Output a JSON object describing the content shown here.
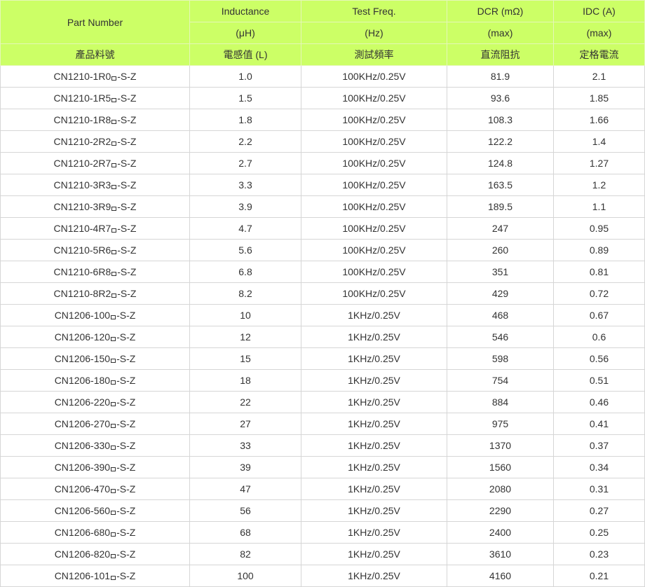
{
  "header": {
    "part_number": "Part Number",
    "part_number_zh": "產品料號",
    "inductance": "Inductance",
    "inductance_unit": "(μH)",
    "inductance_zh": "電感值 (L)",
    "test_freq": "Test Freq.",
    "test_freq_unit": "(Hz)",
    "test_freq_zh": "測試頻率",
    "dcr": "DCR (mΩ)",
    "dcr_unit": "(max)",
    "dcr_zh": "直流阻抗",
    "idc": "IDC (A)",
    "idc_unit": "(max)",
    "idc_zh": "定格電流"
  },
  "rows": [
    {
      "part_prefix": "CN1210-1R0",
      "part_suffix": "-S-Z",
      "inductance": "1.0",
      "freq": "100KHz/0.25V",
      "dcr": "81.9",
      "idc": "2.1"
    },
    {
      "part_prefix": "CN1210-1R5",
      "part_suffix": "-S-Z",
      "inductance": "1.5",
      "freq": "100KHz/0.25V",
      "dcr": "93.6",
      "idc": "1.85"
    },
    {
      "part_prefix": "CN1210-1R8",
      "part_suffix": "-S-Z",
      "inductance": "1.8",
      "freq": "100KHz/0.25V",
      "dcr": "108.3",
      "idc": "1.66"
    },
    {
      "part_prefix": "CN1210-2R2",
      "part_suffix": "-S-Z",
      "inductance": "2.2",
      "freq": "100KHz/0.25V",
      "dcr": "122.2",
      "idc": "1.4"
    },
    {
      "part_prefix": "CN1210-2R7",
      "part_suffix": "-S-Z",
      "inductance": "2.7",
      "freq": "100KHz/0.25V",
      "dcr": "124.8",
      "idc": "1.27"
    },
    {
      "part_prefix": "CN1210-3R3",
      "part_suffix": "-S-Z",
      "inductance": "3.3",
      "freq": "100KHz/0.25V",
      "dcr": "163.5",
      "idc": "1.2"
    },
    {
      "part_prefix": "CN1210-3R9",
      "part_suffix": "-S-Z",
      "inductance": "3.9",
      "freq": "100KHz/0.25V",
      "dcr": "189.5",
      "idc": "1.1"
    },
    {
      "part_prefix": "CN1210-4R7",
      "part_suffix": "-S-Z",
      "inductance": "4.7",
      "freq": "100KHz/0.25V",
      "dcr": "247",
      "idc": "0.95"
    },
    {
      "part_prefix": "CN1210-5R6",
      "part_suffix": "-S-Z",
      "inductance": "5.6",
      "freq": "100KHz/0.25V",
      "dcr": "260",
      "idc": "0.89"
    },
    {
      "part_prefix": "CN1210-6R8",
      "part_suffix": "-S-Z",
      "inductance": "6.8",
      "freq": "100KHz/0.25V",
      "dcr": "351",
      "idc": "0.81"
    },
    {
      "part_prefix": "CN1210-8R2",
      "part_suffix": "-S-Z",
      "inductance": "8.2",
      "freq": "100KHz/0.25V",
      "dcr": "429",
      "idc": "0.72"
    },
    {
      "part_prefix": "CN1206-100",
      "part_suffix": "-S-Z",
      "inductance": "10",
      "freq": "1KHz/0.25V",
      "dcr": "468",
      "idc": "0.67"
    },
    {
      "part_prefix": "CN1206-120",
      "part_suffix": "-S-Z",
      "inductance": "12",
      "freq": "1KHz/0.25V",
      "dcr": "546",
      "idc": "0.6"
    },
    {
      "part_prefix": "CN1206-150",
      "part_suffix": "-S-Z",
      "inductance": "15",
      "freq": "1KHz/0.25V",
      "dcr": "598",
      "idc": "0.56"
    },
    {
      "part_prefix": "CN1206-180",
      "part_suffix": "-S-Z",
      "inductance": "18",
      "freq": "1KHz/0.25V",
      "dcr": "754",
      "idc": "0.51"
    },
    {
      "part_prefix": "CN1206-220",
      "part_suffix": "-S-Z",
      "inductance": "22",
      "freq": "1KHz/0.25V",
      "dcr": "884",
      "idc": "0.46"
    },
    {
      "part_prefix": "CN1206-270",
      "part_suffix": "-S-Z",
      "inductance": "27",
      "freq": "1KHz/0.25V",
      "dcr": "975",
      "idc": "0.41"
    },
    {
      "part_prefix": "CN1206-330",
      "part_suffix": "-S-Z",
      "inductance": "33",
      "freq": "1KHz/0.25V",
      "dcr": "1370",
      "idc": "0.37"
    },
    {
      "part_prefix": "CN1206-390",
      "part_suffix": "-S-Z",
      "inductance": "39",
      "freq": "1KHz/0.25V",
      "dcr": "1560",
      "idc": "0.34"
    },
    {
      "part_prefix": "CN1206-470",
      "part_suffix": "-S-Z",
      "inductance": "47",
      "freq": "1KHz/0.25V",
      "dcr": "2080",
      "idc": "0.31"
    },
    {
      "part_prefix": "CN1206-560",
      "part_suffix": "-S-Z",
      "inductance": "56",
      "freq": "1KHz/0.25V",
      "dcr": "2290",
      "idc": "0.27"
    },
    {
      "part_prefix": "CN1206-680",
      "part_suffix": "-S-Z",
      "inductance": "68",
      "freq": "1KHz/0.25V",
      "dcr": "2400",
      "idc": "0.25"
    },
    {
      "part_prefix": "CN1206-820",
      "part_suffix": "-S-Z",
      "inductance": "82",
      "freq": "1KHz/0.25V",
      "dcr": "3610",
      "idc": "0.23"
    },
    {
      "part_prefix": "CN1206-101",
      "part_suffix": "-S-Z",
      "inductance": "100",
      "freq": "1KHz/0.25V",
      "dcr": "4160",
      "idc": "0.21"
    }
  ]
}
